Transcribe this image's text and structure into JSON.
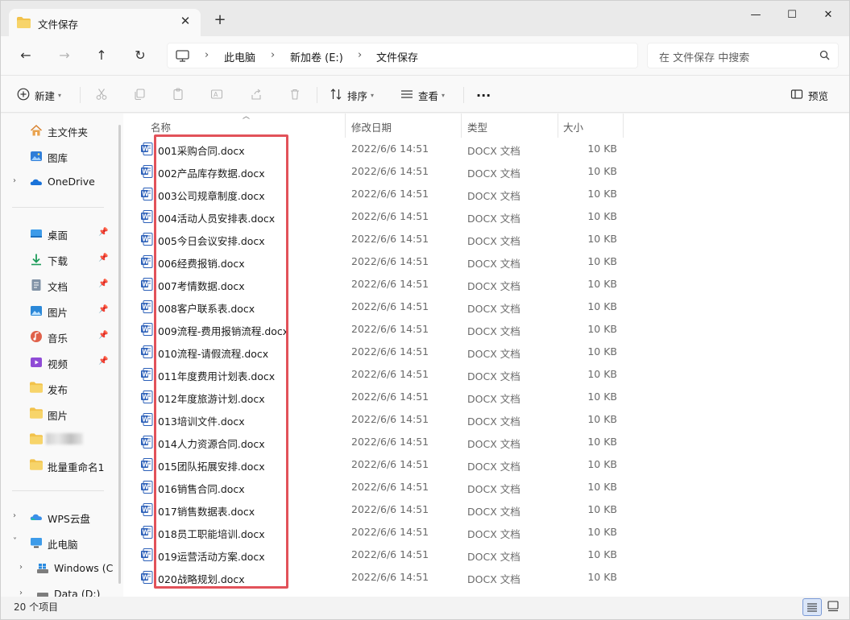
{
  "tab": {
    "title": "文件保存",
    "close_glyph": "✕",
    "new_tab_glyph": "+"
  },
  "window_controls": {
    "minimize": "—",
    "maximize": "☐",
    "close": "✕"
  },
  "nav": {
    "back": "←",
    "forward": "→",
    "up": "↑",
    "refresh": "↻"
  },
  "breadcrumbs": [
    "此电脑",
    "新加卷 (E:)",
    "文件保存"
  ],
  "breadcrumb_sep": "›",
  "search": {
    "placeholder": "在 文件保存 中搜索"
  },
  "toolbar": {
    "new_label": "新建",
    "sort_label": "排序",
    "view_label": "查看",
    "more_label": "···",
    "preview_label": "预览"
  },
  "sidebar": {
    "items": [
      {
        "label": "主文件夹",
        "icon": "home-icon"
      },
      {
        "label": "图库",
        "icon": "gallery-icon"
      },
      {
        "label": "OneDrive",
        "icon": "onedrive-icon"
      },
      {
        "label": "桌面",
        "icon": "desktop-icon"
      },
      {
        "label": "下载",
        "icon": "download-icon"
      },
      {
        "label": "文档",
        "icon": "documents-icon"
      },
      {
        "label": "图片",
        "icon": "pictures-icon"
      },
      {
        "label": "音乐",
        "icon": "music-icon"
      },
      {
        "label": "视频",
        "icon": "videos-icon"
      },
      {
        "label": "发布",
        "icon": "folder-icon"
      },
      {
        "label": "图片",
        "icon": "folder-icon"
      },
      {
        "label": "",
        "icon": "folder-icon"
      },
      {
        "label": "批量重命名1",
        "icon": "folder-icon"
      },
      {
        "label": "WPS云盘",
        "icon": "wps-cloud-icon"
      },
      {
        "label": "此电脑",
        "icon": "this-pc-icon"
      },
      {
        "label": "Windows (C",
        "icon": "windows-drive-icon"
      },
      {
        "label": "Data (D:)",
        "icon": "drive-icon"
      }
    ]
  },
  "columns": {
    "name": "名称",
    "modified": "修改日期",
    "type": "类型",
    "size": "大小"
  },
  "files": [
    {
      "name": "001采购合同.docx",
      "date": "2022/6/6 14:51",
      "type": "DOCX 文档",
      "size": "10 KB"
    },
    {
      "name": "002产品库存数据.docx",
      "date": "2022/6/6 14:51",
      "type": "DOCX 文档",
      "size": "10 KB"
    },
    {
      "name": "003公司规章制度.docx",
      "date": "2022/6/6 14:51",
      "type": "DOCX 文档",
      "size": "10 KB"
    },
    {
      "name": "004活动人员安排表.docx",
      "date": "2022/6/6 14:51",
      "type": "DOCX 文档",
      "size": "10 KB"
    },
    {
      "name": "005今日会议安排.docx",
      "date": "2022/6/6 14:51",
      "type": "DOCX 文档",
      "size": "10 KB"
    },
    {
      "name": "006经费报销.docx",
      "date": "2022/6/6 14:51",
      "type": "DOCX 文档",
      "size": "10 KB"
    },
    {
      "name": "007考情数据.docx",
      "date": "2022/6/6 14:51",
      "type": "DOCX 文档",
      "size": "10 KB"
    },
    {
      "name": "008客户联系表.docx",
      "date": "2022/6/6 14:51",
      "type": "DOCX 文档",
      "size": "10 KB"
    },
    {
      "name": "009流程-费用报销流程.docx",
      "date": "2022/6/6 14:51",
      "type": "DOCX 文档",
      "size": "10 KB"
    },
    {
      "name": "010流程-请假流程.docx",
      "date": "2022/6/6 14:51",
      "type": "DOCX 文档",
      "size": "10 KB"
    },
    {
      "name": "011年度费用计划表.docx",
      "date": "2022/6/6 14:51",
      "type": "DOCX 文档",
      "size": "10 KB"
    },
    {
      "name": "012年度旅游计划.docx",
      "date": "2022/6/6 14:51",
      "type": "DOCX 文档",
      "size": "10 KB"
    },
    {
      "name": "013培训文件.docx",
      "date": "2022/6/6 14:51",
      "type": "DOCX 文档",
      "size": "10 KB"
    },
    {
      "name": "014人力资源合同.docx",
      "date": "2022/6/6 14:51",
      "type": "DOCX 文档",
      "size": "10 KB"
    },
    {
      "name": "015团队拓展安排.docx",
      "date": "2022/6/6 14:51",
      "type": "DOCX 文档",
      "size": "10 KB"
    },
    {
      "name": "016销售合同.docx",
      "date": "2022/6/6 14:51",
      "type": "DOCX 文档",
      "size": "10 KB"
    },
    {
      "name": "017销售数据表.docx",
      "date": "2022/6/6 14:51",
      "type": "DOCX 文档",
      "size": "10 KB"
    },
    {
      "name": "018员工职能培训.docx",
      "date": "2022/6/6 14:51",
      "type": "DOCX 文档",
      "size": "10 KB"
    },
    {
      "name": "019运营活动方案.docx",
      "date": "2022/6/6 14:51",
      "type": "DOCX 文档",
      "size": "10 KB"
    },
    {
      "name": "020战略规划.docx",
      "date": "2022/6/6 14:51",
      "type": "DOCX 文档",
      "size": "10 KB"
    }
  ],
  "status": {
    "item_count": "20 个项目"
  },
  "colors": {
    "accent": "#0067c0",
    "highlight_box": "#e2525a",
    "word_blue": "#2b5fb8"
  }
}
